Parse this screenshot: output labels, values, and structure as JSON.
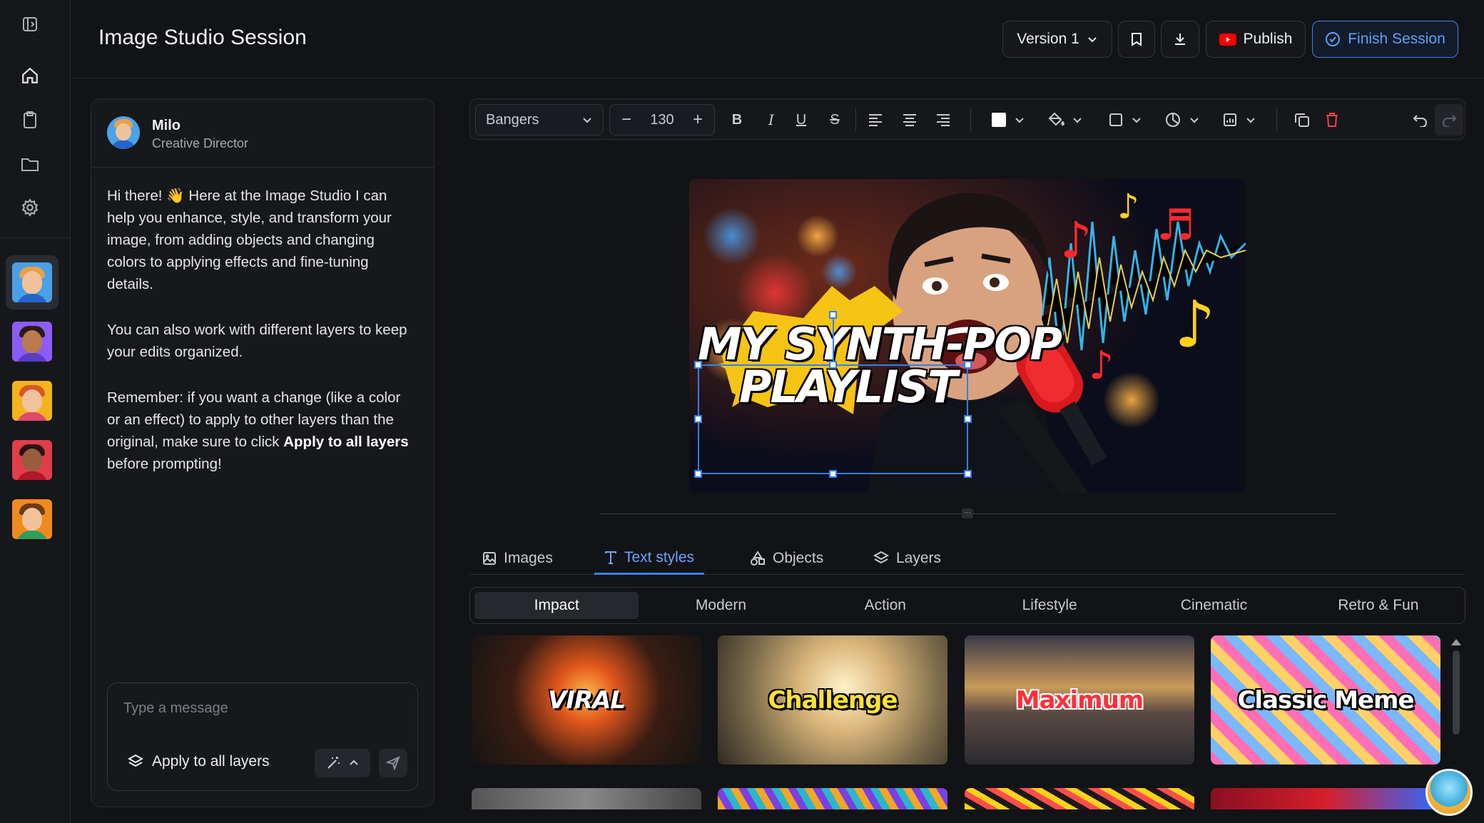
{
  "header": {
    "title": "Image Studio Session",
    "version_label": "Version 1",
    "publish_label": "Publish",
    "finish_label": "Finish Session"
  },
  "chat": {
    "agent_name": "Milo",
    "agent_role": "Creative Director",
    "messages": [
      "Hi there! 👋 Here at the Image Studio I can help you enhance, style, and transform your image, from adding objects and changing colors to applying effects and fine-tuning details.",
      "You can also work with different layers to keep your edits organized.",
      "Remember: if you want a change (like a color or an effect) to apply to other layers than the original, make sure to click "
    ],
    "message3_bold": "Apply to all layers",
    "message3_tail": " before prompting!",
    "input_placeholder": "Type a message",
    "apply_label": "Apply to all layers"
  },
  "toolbar": {
    "font": "Bangers",
    "font_size": "130"
  },
  "canvas": {
    "headline_line1": "MY SYNTH-POP",
    "headline_line2": "PLAYLIST"
  },
  "tabs": [
    {
      "label": "Images"
    },
    {
      "label": "Text styles"
    },
    {
      "label": "Objects"
    },
    {
      "label": "Layers"
    }
  ],
  "active_tab": "Text styles",
  "subtabs": [
    "Impact",
    "Modern",
    "Action",
    "Lifestyle",
    "Cinematic",
    "Retro & Fun"
  ],
  "active_subtab": "Impact",
  "style_cards": [
    {
      "label": "VIRAL",
      "color": "#ffffff"
    },
    {
      "label": "Challenge",
      "color": "#ffe13a"
    },
    {
      "label": "Maximum",
      "color": "#ff2f3a"
    },
    {
      "label": "Classic Meme",
      "color": "#ffffff"
    }
  ],
  "colors": {
    "accent": "#3b82f6",
    "publish_red": "#ff0000",
    "delete_red": "#ef4444"
  }
}
